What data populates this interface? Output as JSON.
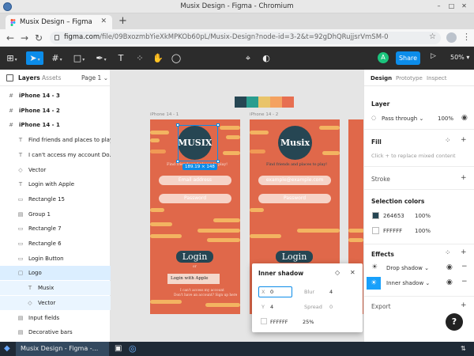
{
  "window": {
    "title": "Musix Design - Figma - Chromium",
    "btn_min": "–",
    "btn_max": "□",
    "btn_close": "✕"
  },
  "browser": {
    "tab_label": "Musix Design – Figma",
    "tab_close": "✕",
    "new_tab": "+",
    "nav_back": "←",
    "nav_fwd": "→",
    "nav_reload": "↻",
    "url_host": "figma.com",
    "url_path": "/file/09BxozmbYieXkMPKOb60pL/Musix-Design?node-id=3-2&t=92gDhQRujjsrVmSM-0",
    "star": "☆",
    "menu": "⋮"
  },
  "toolbar": {
    "main_menu": "⊞",
    "move": "➤",
    "frame": "#",
    "shape": "□",
    "pen": "✒",
    "text": "T",
    "resources": "⁘",
    "hand": "✋",
    "comment": "◯",
    "comp": "⌖",
    "contrast": "◐",
    "avatar_letter": "A",
    "share": "Share",
    "play": "▷",
    "zoom": "50%",
    "caret": "▾"
  },
  "layers_panel": {
    "tab_layers": "Layers",
    "tab_assets": "Assets",
    "page": "Page 1 ⌄",
    "items": [
      {
        "label": "iPhone 14 - 3",
        "icon": "#"
      },
      {
        "label": "iPhone 14 - 2",
        "icon": "#"
      },
      {
        "label": "iPhone 14 - 1",
        "icon": "#"
      },
      {
        "label": "Find friends and places to play!",
        "icon": "T"
      },
      {
        "label": "I can't access my account Do...",
        "icon": "T"
      },
      {
        "label": "Vector",
        "icon": "◇"
      },
      {
        "label": "Login with Apple",
        "icon": "T"
      },
      {
        "label": "Rectangle 15",
        "icon": "▭"
      },
      {
        "label": "Group 1",
        "icon": "▤"
      },
      {
        "label": "Rectangle 7",
        "icon": "▭"
      },
      {
        "label": "Rectangle 6",
        "icon": "▭"
      },
      {
        "label": "Login Button",
        "icon": "▭"
      },
      {
        "label": "Logo",
        "icon": "▢"
      },
      {
        "label": "Musix",
        "icon": "T"
      },
      {
        "label": "Vector",
        "icon": "◇"
      },
      {
        "label": "Input fields",
        "icon": "▤"
      },
      {
        "label": "Decorative bars",
        "icon": "▤"
      }
    ]
  },
  "canvas": {
    "palette": [
      "#264653",
      "#2a9d8f",
      "#e9c46a",
      "#f4a261",
      "#e76f51"
    ],
    "frame1_label": "iPhone 14 - 1",
    "frame2_label": "iPhone 14 - 2",
    "logo_text": "MUSIX",
    "logo_text2": "Musix",
    "subtitle": "Find friends and places to play!",
    "email_ph": "Email address",
    "email_ph2": "example@example.com",
    "password_ph": "Password",
    "login_btn": "Login",
    "or_text": "or",
    "apple_btn": "Login with Apple",
    "apple_glyph": "",
    "fine1": "I can't access my account",
    "fine2": "Don't have an account? Sign up here",
    "sel_dims": "189.19 × 148"
  },
  "inner_shadow_modal": {
    "title": "Inner shadow",
    "icon_drop": "◇",
    "icon_close": "✕",
    "x_label": "X",
    "x_value": "0",
    "blur_label": "Blur",
    "blur_value": "4",
    "y_label": "Y",
    "y_value": "4",
    "spread_label": "Spread",
    "spread_value": "0",
    "color_hex": "FFFFFF",
    "opacity": "25%"
  },
  "right_panel": {
    "tab_design": "Design",
    "tab_prototype": "Prototype",
    "tab_inspect": "Inspect",
    "layer_title": "Layer",
    "blend_mode": "Pass through ⌄",
    "layer_opacity": "100%",
    "fill_title": "Fill",
    "fill_hint": "Click + to replace mixed content",
    "stroke_title": "Stroke",
    "selection_colors_title": "Selection colors",
    "colors": [
      {
        "hex": "264653",
        "opacity": "100%",
        "swatch": "#264653"
      },
      {
        "hex": "FFFFFF",
        "opacity": "100%",
        "swatch": "#ffffff"
      }
    ],
    "effects_title": "Effects",
    "effects": [
      {
        "name": "Drop shadow ⌄"
      },
      {
        "name": "Inner shadow ⌄"
      }
    ],
    "export_title": "Export",
    "plus": "+",
    "minus": "−",
    "eye": "◉",
    "grid": "⁘",
    "help": "?"
  },
  "taskbar": {
    "start": "◆",
    "window_label": "Musix Design - Figma -...",
    "term": "▣",
    "chrome": "◎",
    "tray": "⇅"
  }
}
